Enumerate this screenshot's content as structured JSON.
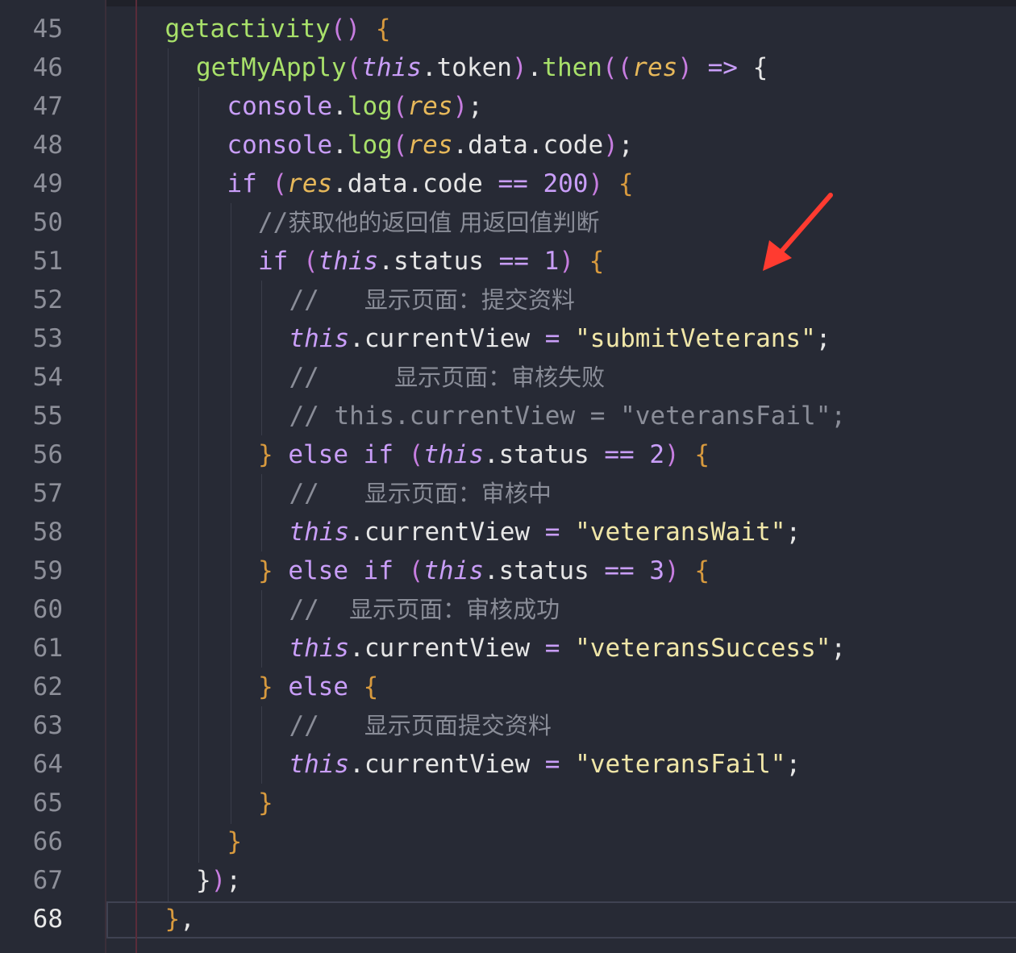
{
  "editor": {
    "current_line_number": "68",
    "lines": [
      {
        "n": "45",
        "indent": 5,
        "tokens": [
          [
            "fn",
            "getactivity"
          ],
          [
            "pn",
            "()"
          ],
          [
            "pl",
            " "
          ],
          [
            "br",
            "{"
          ]
        ]
      },
      {
        "n": "46",
        "indent": 6,
        "tokens": [
          [
            "fn",
            "getMyApply"
          ],
          [
            "pn",
            "("
          ],
          [
            "this",
            "this"
          ],
          [
            "pl",
            ".token"
          ],
          [
            "pn",
            ")"
          ],
          [
            "pl",
            "."
          ],
          [
            "fn",
            "then"
          ],
          [
            "pn",
            "(("
          ],
          [
            "res",
            "res"
          ],
          [
            "pn",
            ")"
          ],
          [
            "pl",
            " "
          ],
          [
            "op",
            "=>"
          ],
          [
            "pl",
            " {"
          ]
        ]
      },
      {
        "n": "47",
        "indent": 7,
        "tokens": [
          [
            "kw",
            "console"
          ],
          [
            "pl",
            "."
          ],
          [
            "fn",
            "log"
          ],
          [
            "pn",
            "("
          ],
          [
            "res",
            "res"
          ],
          [
            "pn",
            ")"
          ],
          [
            "pl",
            ";"
          ]
        ]
      },
      {
        "n": "48",
        "indent": 7,
        "tokens": [
          [
            "kw",
            "console"
          ],
          [
            "pl",
            "."
          ],
          [
            "fn",
            "log"
          ],
          [
            "pn",
            "("
          ],
          [
            "res",
            "res"
          ],
          [
            "pl",
            ".data.code"
          ],
          [
            "pn",
            ")"
          ],
          [
            "pl",
            ";"
          ]
        ]
      },
      {
        "n": "49",
        "indent": 7,
        "tokens": [
          [
            "kw",
            "if"
          ],
          [
            "pl",
            " "
          ],
          [
            "pn",
            "("
          ],
          [
            "res",
            "res"
          ],
          [
            "pl",
            ".data.code "
          ],
          [
            "op",
            "=="
          ],
          [
            "pl",
            " "
          ],
          [
            "num",
            "200"
          ],
          [
            "pn",
            ")"
          ],
          [
            "pl",
            " "
          ],
          [
            "br",
            "{"
          ]
        ]
      },
      {
        "n": "50",
        "indent": 8,
        "tokens": [
          [
            "cm",
            "//"
          ],
          [
            "cmcn",
            "获取他的返回值 用返回值判断"
          ]
        ]
      },
      {
        "n": "51",
        "indent": 8,
        "tokens": [
          [
            "kw",
            "if"
          ],
          [
            "pl",
            " "
          ],
          [
            "pn",
            "("
          ],
          [
            "this",
            "this"
          ],
          [
            "pl",
            ".status "
          ],
          [
            "op",
            "=="
          ],
          [
            "pl",
            " "
          ],
          [
            "num",
            "1"
          ],
          [
            "pn",
            ")"
          ],
          [
            "pl",
            " "
          ],
          [
            "br",
            "{"
          ]
        ]
      },
      {
        "n": "52",
        "indent": 9,
        "tokens": [
          [
            "cm",
            "//   "
          ],
          [
            "cmcn",
            "显示页面：提交资料"
          ]
        ]
      },
      {
        "n": "53",
        "indent": 9,
        "tokens": [
          [
            "this",
            "this"
          ],
          [
            "pl",
            ".currentView "
          ],
          [
            "op",
            "="
          ],
          [
            "pl",
            " "
          ],
          [
            "str",
            "\"submitVeterans\""
          ],
          [
            "pl",
            ";"
          ]
        ]
      },
      {
        "n": "54",
        "indent": 9,
        "tokens": [
          [
            "cm",
            "//     "
          ],
          [
            "cmcn",
            "显示页面：审核失败"
          ]
        ]
      },
      {
        "n": "55",
        "indent": 9,
        "tokens": [
          [
            "cm",
            "// this.currentView = \"veteransFail\";"
          ]
        ]
      },
      {
        "n": "56",
        "indent": 8,
        "tokens": [
          [
            "br",
            "}"
          ],
          [
            "pl",
            " "
          ],
          [
            "kw",
            "else if"
          ],
          [
            "pl",
            " "
          ],
          [
            "pn",
            "("
          ],
          [
            "this",
            "this"
          ],
          [
            "pl",
            ".status "
          ],
          [
            "op",
            "=="
          ],
          [
            "pl",
            " "
          ],
          [
            "num",
            "2"
          ],
          [
            "pn",
            ")"
          ],
          [
            "pl",
            " "
          ],
          [
            "br",
            "{"
          ]
        ]
      },
      {
        "n": "57",
        "indent": 9,
        "tokens": [
          [
            "cm",
            "//   "
          ],
          [
            "cmcn",
            "显示页面：审核中"
          ]
        ]
      },
      {
        "n": "58",
        "indent": 9,
        "tokens": [
          [
            "this",
            "this"
          ],
          [
            "pl",
            ".currentView "
          ],
          [
            "op",
            "="
          ],
          [
            "pl",
            " "
          ],
          [
            "str",
            "\"veteransWait\""
          ],
          [
            "pl",
            ";"
          ]
        ]
      },
      {
        "n": "59",
        "indent": 8,
        "tokens": [
          [
            "br",
            "}"
          ],
          [
            "pl",
            " "
          ],
          [
            "kw",
            "else if"
          ],
          [
            "pl",
            " "
          ],
          [
            "pn",
            "("
          ],
          [
            "this",
            "this"
          ],
          [
            "pl",
            ".status "
          ],
          [
            "op",
            "=="
          ],
          [
            "pl",
            " "
          ],
          [
            "num",
            "3"
          ],
          [
            "pn",
            ")"
          ],
          [
            "pl",
            " "
          ],
          [
            "br",
            "{"
          ]
        ]
      },
      {
        "n": "60",
        "indent": 9,
        "tokens": [
          [
            "cm",
            "//  "
          ],
          [
            "cmcn",
            "显示页面：审核成功"
          ]
        ]
      },
      {
        "n": "61",
        "indent": 9,
        "tokens": [
          [
            "this",
            "this"
          ],
          [
            "pl",
            ".currentView "
          ],
          [
            "op",
            "="
          ],
          [
            "pl",
            " "
          ],
          [
            "str",
            "\"veteransSuccess\""
          ],
          [
            "pl",
            ";"
          ]
        ]
      },
      {
        "n": "62",
        "indent": 8,
        "tokens": [
          [
            "br",
            "}"
          ],
          [
            "pl",
            " "
          ],
          [
            "kw",
            "else"
          ],
          [
            "pl",
            " "
          ],
          [
            "br",
            "{"
          ]
        ]
      },
      {
        "n": "63",
        "indent": 9,
        "tokens": [
          [
            "cm",
            "//   "
          ],
          [
            "cmcn",
            "显示页面提交资料"
          ]
        ]
      },
      {
        "n": "64",
        "indent": 9,
        "tokens": [
          [
            "this",
            "this"
          ],
          [
            "pl",
            ".currentView "
          ],
          [
            "op",
            "="
          ],
          [
            "pl",
            " "
          ],
          [
            "str",
            "\"veteransFail\""
          ],
          [
            "pl",
            ";"
          ]
        ]
      },
      {
        "n": "65",
        "indent": 8,
        "tokens": [
          [
            "br",
            "}"
          ]
        ]
      },
      {
        "n": "66",
        "indent": 7,
        "tokens": [
          [
            "br",
            "}"
          ]
        ]
      },
      {
        "n": "67",
        "indent": 6,
        "tokens": [
          [
            "pl",
            "}"
          ],
          [
            "pn",
            ")"
          ],
          [
            "pl",
            ";"
          ]
        ]
      },
      {
        "n": "68",
        "indent": 5,
        "tokens": [
          [
            "br",
            "}"
          ],
          [
            "pl",
            ","
          ]
        ]
      }
    ]
  },
  "annotation": {
    "color": "#ff3b30",
    "icon": "red-arrow-icon"
  }
}
